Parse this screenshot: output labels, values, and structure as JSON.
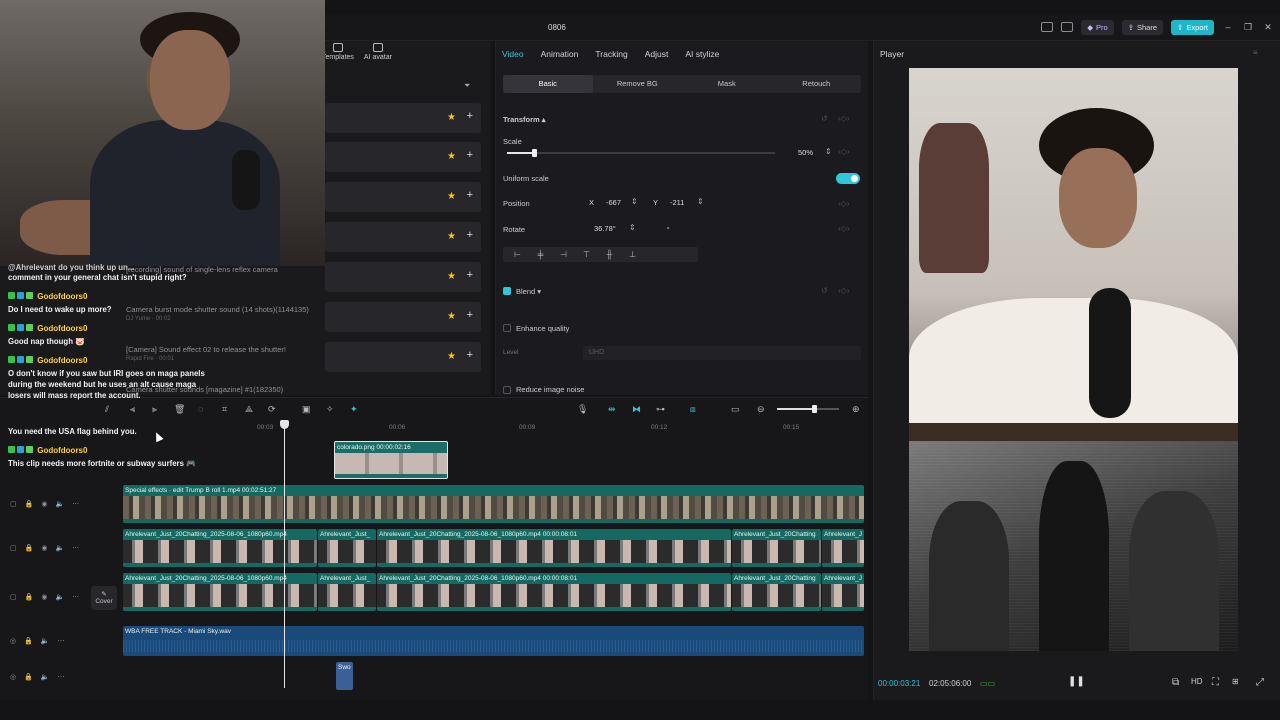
{
  "window": {
    "doc_title": "0806",
    "pro_label": "Pro",
    "share_label": "Share",
    "export_label": "Export",
    "minimize_label": "–",
    "maximize_label": "❐",
    "close_label": "✕"
  },
  "media_panel": {
    "tabs": [
      {
        "label": "Templates"
      },
      {
        "label": "AI avatar"
      }
    ],
    "filter_label": "⏷",
    "sounds": [
      {
        "title": "[recording] sound of single-lens reflex camera",
        "sub": ""
      },
      {
        "title": "Camera burst mode shutter sound (14 shots)(1144135)",
        "sub": "DJ Yume · 00:02"
      },
      {
        "title": "[Camera] Sound effect 02 to release the shutter!",
        "sub": "Rapid Fire · 00:01"
      },
      {
        "title": "Camera shutter sounds [magazine] #1(182350)",
        "sub": ""
      }
    ]
  },
  "chat": {
    "messages": [
      {
        "type": "msg",
        "text": "@Ahrelevant do you think up un..."
      },
      {
        "type": "msg",
        "text": "comment in your general chat isn't stupid right?"
      },
      {
        "type": "user",
        "text": "Godofdoors0"
      },
      {
        "type": "msg",
        "text": "Do I need to wake up more?"
      },
      {
        "type": "user",
        "text": "Godofdoors0"
      },
      {
        "type": "msg",
        "text": "Good nap though 🐷"
      },
      {
        "type": "user",
        "text": "Godofdoors0"
      },
      {
        "type": "msg",
        "text": "O don't know if you saw but IRI goes on maga panels"
      },
      {
        "type": "msg",
        "text": "during the weekend but he uses an alt cause maga"
      },
      {
        "type": "msg",
        "text": "losers will mass report the account."
      },
      {
        "type": "msg",
        "text": "You need the USA flag behind you."
      },
      {
        "type": "user",
        "text": "Godofdoors0"
      },
      {
        "type": "msg",
        "text": "This clip needs more fortnite or subway surfers 🎮"
      }
    ]
  },
  "inspector": {
    "tabs": [
      {
        "label": "Video",
        "active": true
      },
      {
        "label": "Animation"
      },
      {
        "label": "Tracking"
      },
      {
        "label": "Adjust"
      },
      {
        "label": "AI stylize"
      }
    ],
    "subtabs": [
      {
        "label": "Basic",
        "active": true
      },
      {
        "label": "Remove BG"
      },
      {
        "label": "Mask"
      },
      {
        "label": "Retouch"
      }
    ],
    "transform_label": "Transform ▴",
    "scale_label": "Scale",
    "scale_value": "50%",
    "scale_fraction": 0.1,
    "uniform_scale_label": "Uniform scale",
    "uniform_scale_on": true,
    "position_label": "Position",
    "pos_x_label": "X",
    "pos_x": "-667",
    "pos_y_label": "Y",
    "pos_y": "-211",
    "rotate_label": "Rotate",
    "rotate_value": "36.78°",
    "blend_label": "Blend ▾",
    "enhance_label": "Enhance quality",
    "level_label": "Level",
    "level_value": "UHD",
    "reduce_noise_label": "Reduce image noise"
  },
  "player": {
    "title": "Player",
    "current_time": "00:00:03:21",
    "total_time": "02:05:06:00"
  },
  "timeline": {
    "ticks": [
      "00:03",
      "00:06",
      "00:09",
      "00:12",
      "00:15"
    ],
    "zoom_fraction": 0.6,
    "cover_label": "Cover",
    "clips": {
      "overlay": "colorado.png  00:00:02:16",
      "fx": "Special effects · edit   Trump B roll 1.mp4  00:02:51:27",
      "v2a": "Ahrelevant_Just_20Chatting_2025-08-06_1080p60.mp4",
      "v2b": "Ahrelevant_Just_",
      "v2c": "Ahrelevant_Just_20Chatting_2025-08-06_1080p60.mp4  00:00:08:01",
      "v2d": "Ahrelevant_Just_20Chatting",
      "v2e": "Ahrelevant_J",
      "v3a": "Ahrelevant_Just_20Chatting_2025-08-06_1080p60.mp4",
      "v3b": "Ahrelevant_Just_",
      "v3c": "Ahrelevant_Just_20Chatting_2025-08-06_1080p60.mp4  00:00:08:01",
      "v3d": "Ahrelevant_Just_20Chatting",
      "v3e": "Ahrelevant_J",
      "audio": "WBA FREE TRACK - Miami Sky.wav",
      "sfx": "Swo"
    }
  }
}
